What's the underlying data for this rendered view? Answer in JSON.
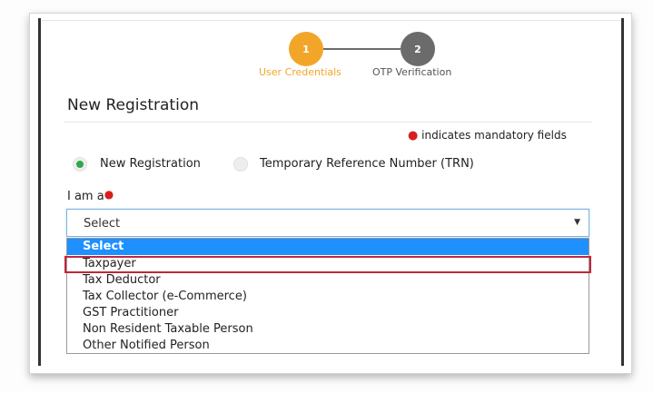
{
  "stepper": {
    "steps": [
      {
        "number": "1",
        "label": "User Credentials",
        "state": "active"
      },
      {
        "number": "2",
        "label": "OTP Verification",
        "state": "pending"
      }
    ]
  },
  "page": {
    "title": "New Registration",
    "mandatory_note": "indicates mandatory fields"
  },
  "registration_type": {
    "options": [
      "New Registration",
      "Temporary Reference Number (TRN)"
    ],
    "selected": "New Registration"
  },
  "role": {
    "label": "I am a",
    "select_value": "Select",
    "options": [
      "Select",
      "Taxpayer",
      "Tax Deductor",
      "Tax Collector (e-Commerce)",
      "GST Practitioner",
      "Non Resident Taxable Person",
      "Other Notified Person"
    ],
    "highlighted_option": "Select",
    "annotated_option": "Taxpayer"
  },
  "colors": {
    "step_active": "#f2a629",
    "step_pending": "#6b6b6b",
    "radio_selected": "#2ea84a",
    "option_highlight": "#1e90ff",
    "annotation_box": "#c0283a",
    "required_marker": "#d61f1f"
  }
}
